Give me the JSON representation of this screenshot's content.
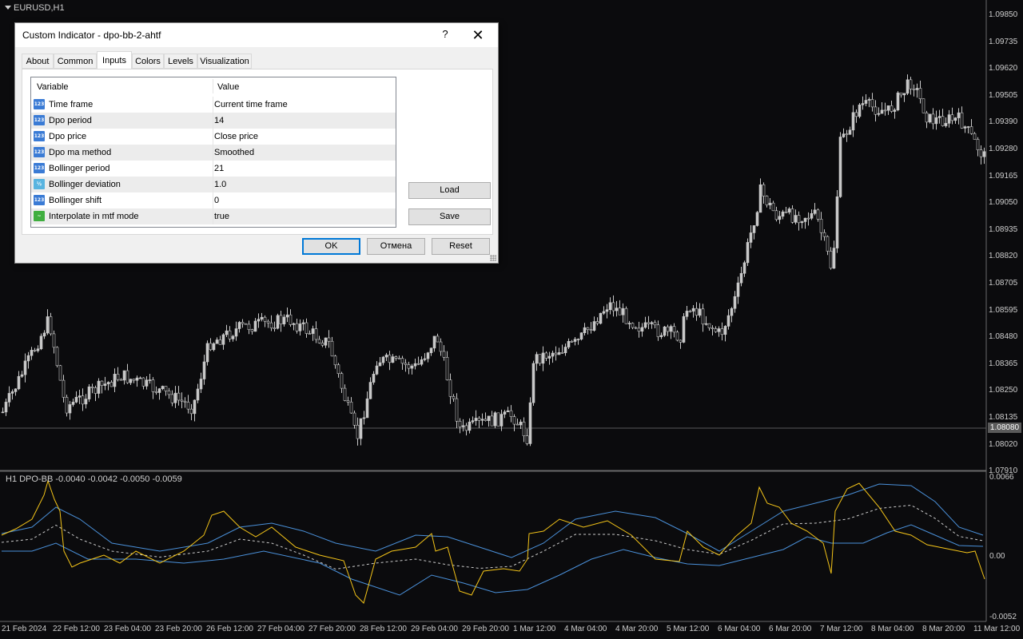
{
  "chart": {
    "symbol": "EURUSD,H1",
    "indicator_label": "H1 DPO-BB -0.0040 -0.0042 -0.0050 -0.0059",
    "price_axis": [
      "1.09850",
      "1.09735",
      "1.09620",
      "1.09505",
      "1.09390",
      "1.09280",
      "1.09165",
      "1.09050",
      "1.08935",
      "1.08820",
      "1.08705",
      "1.08595",
      "1.08480",
      "1.08365",
      "1.08250",
      "1.08135",
      "1.08020",
      "1.07910"
    ],
    "current_price": "1.08080",
    "indicator_axis": [
      "0.0066",
      "0.00",
      "-0.0052"
    ],
    "time_axis": [
      "21 Feb 2024",
      "22 Feb 12:00",
      "23 Feb 04:00",
      "23 Feb 20:00",
      "26 Feb 12:00",
      "27 Feb 04:00",
      "27 Feb 20:00",
      "28 Feb 12:00",
      "29 Feb 04:00",
      "29 Feb 20:00",
      "1 Mar 12:00",
      "4 Mar 04:00",
      "4 Mar 20:00",
      "5 Mar 12:00",
      "6 Mar 04:00",
      "6 Mar 20:00",
      "7 Mar 12:00",
      "8 Mar 04:00",
      "8 Mar 20:00",
      "11 Mar 12:00"
    ],
    "colors": {
      "background": "#0b0b0d",
      "candles": "#c8c8c8",
      "dpo": "#f5c518",
      "bands": "#4a90d9",
      "middle": "#cccccc"
    }
  },
  "dialog": {
    "title": "Custom Indicator - dpo-bb-2-ahtf",
    "help": "?",
    "close": "✕",
    "tabs": [
      "About",
      "Common",
      "Inputs",
      "Colors",
      "Levels",
      "Visualization"
    ],
    "active_tab": "Inputs",
    "grid": {
      "headers": [
        "Variable",
        "Value"
      ],
      "rows": [
        {
          "icon": "123",
          "type": "num",
          "name": "Time frame",
          "value": "Current time frame"
        },
        {
          "icon": "123",
          "type": "num",
          "name": "Dpo period",
          "value": "14"
        },
        {
          "icon": "123",
          "type": "num",
          "name": "Dpo price",
          "value": "Close price"
        },
        {
          "icon": "123",
          "type": "num",
          "name": "Dpo ma method",
          "value": "Smoothed"
        },
        {
          "icon": "123",
          "type": "num",
          "name": "Bollinger period",
          "value": "21"
        },
        {
          "icon": "½",
          "type": "dbl",
          "name": "Bollinger deviation",
          "value": "1.0"
        },
        {
          "icon": "123",
          "type": "num",
          "name": "Bollinger shift",
          "value": "0"
        },
        {
          "icon": "~",
          "type": "bool",
          "name": "Interpolate in mtf mode",
          "value": "true"
        }
      ]
    },
    "buttons": {
      "load": "Load",
      "save": "Save",
      "ok": "OK",
      "cancel": "Отмена",
      "reset": "Reset"
    }
  }
}
